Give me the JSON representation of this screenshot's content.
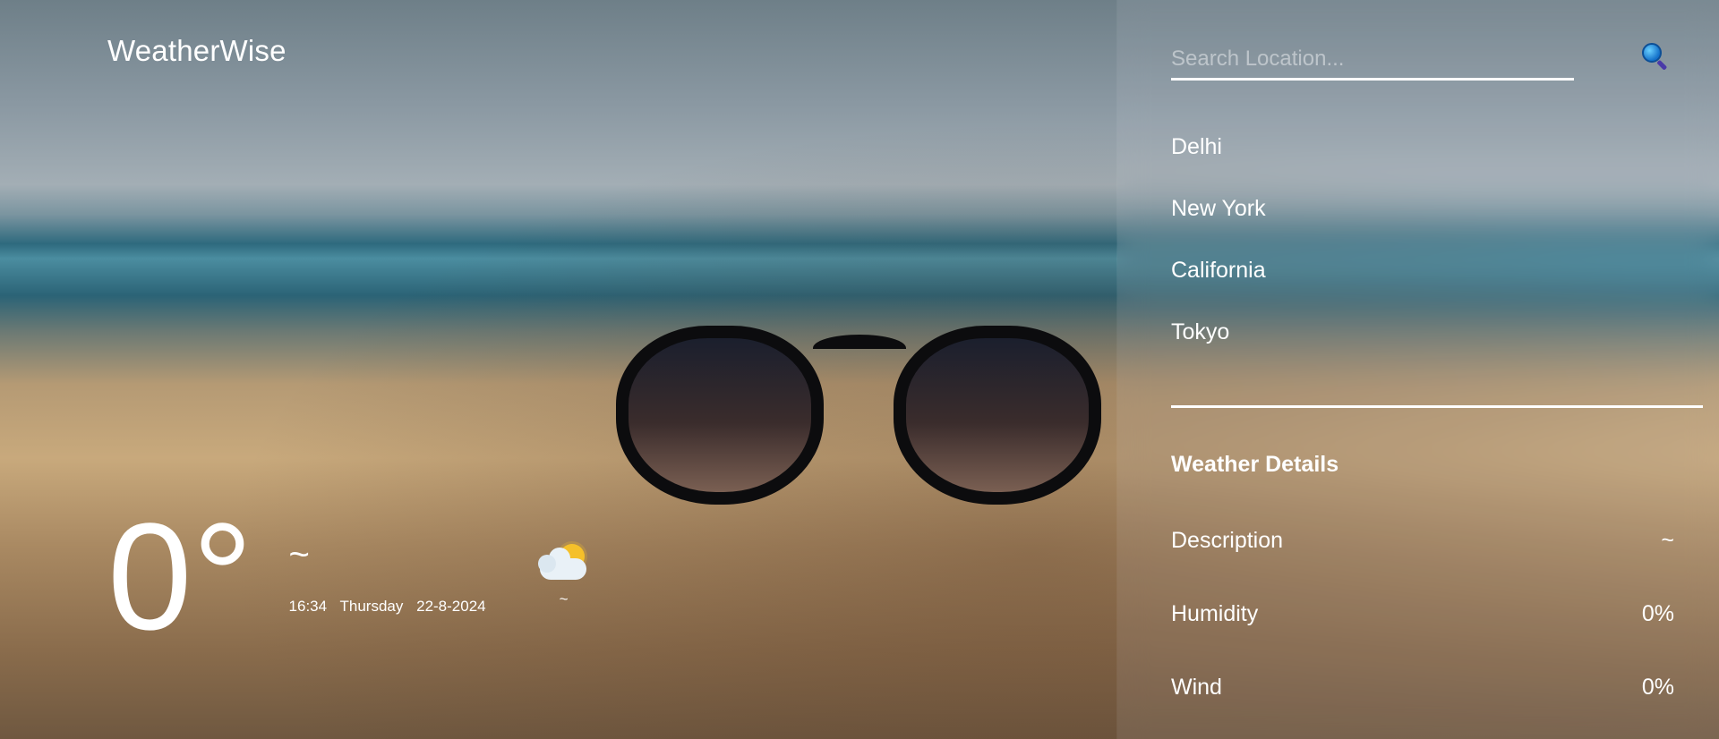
{
  "app": {
    "brand": "WeatherWise"
  },
  "current": {
    "temperature": "0°",
    "city": "~",
    "time": "16:34",
    "day": "Thursday",
    "date": "22-8-2024",
    "condition_icon": "partly-cloudy-icon",
    "condition": "~"
  },
  "search": {
    "placeholder": "Search Location...",
    "icon": "search-icon"
  },
  "locations": [
    "Delhi",
    "New York",
    "California",
    "Tokyo"
  ],
  "details": {
    "title": "Weather Details",
    "rows": [
      {
        "label": "Description",
        "value": "~"
      },
      {
        "label": "Humidity",
        "value": "0%"
      },
      {
        "label": "Wind",
        "value": "0%"
      }
    ]
  }
}
